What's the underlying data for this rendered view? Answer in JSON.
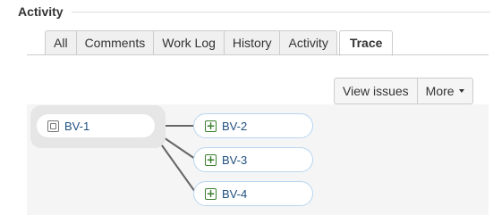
{
  "section": {
    "title": "Activity"
  },
  "tabs": [
    {
      "label": "All",
      "active": false
    },
    {
      "label": "Comments",
      "active": false
    },
    {
      "label": "Work Log",
      "active": false
    },
    {
      "label": "History",
      "active": false
    },
    {
      "label": "Activity",
      "active": false
    },
    {
      "label": "Trace",
      "active": true
    }
  ],
  "toolbar": {
    "view_issues_label": "View issues",
    "more_label": "More"
  },
  "trace": {
    "root": {
      "key": "BV-1",
      "icon": "story-icon"
    },
    "children": [
      {
        "key": "BV-2",
        "icon": "add-icon"
      },
      {
        "key": "BV-3",
        "icon": "add-icon"
      },
      {
        "key": "BV-4",
        "icon": "add-icon"
      }
    ]
  },
  "colors": {
    "link": "#205081",
    "child_border": "#b8d6f0",
    "connector": "#666666",
    "add_icon": "#3b7e2e"
  }
}
